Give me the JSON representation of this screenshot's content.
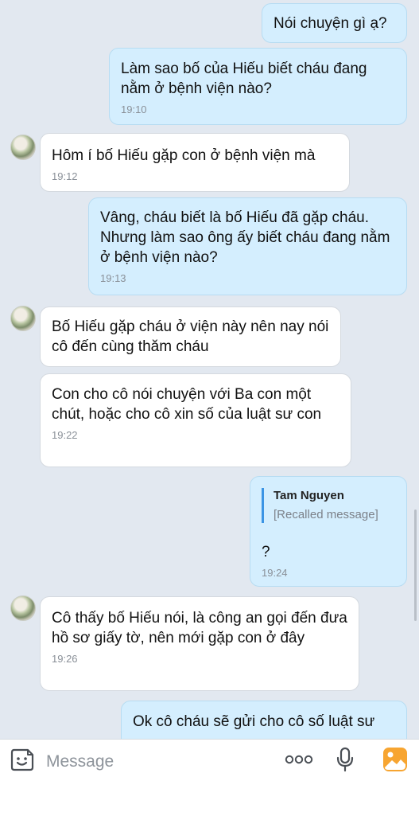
{
  "messages": [
    {
      "dir": "out",
      "text": "Nói chuyện gì ạ?",
      "time": ""
    },
    {
      "dir": "out",
      "text": "Làm sao bố của Hiếu biết cháu đang nằm ở bệnh viện nào?",
      "time": "19:10"
    },
    {
      "dir": "in",
      "text": "Hôm í bố Hiếu gặp con ở bệnh viện mà",
      "time": "19:12"
    },
    {
      "dir": "out",
      "text": "Vâng, cháu biết là bố Hiếu đã gặp cháu. Nhưng làm sao ông ấy biết cháu đang nằm ở bệnh viện nào?",
      "time": "19:13"
    },
    {
      "dir": "in",
      "text": "Bố Hiếu gặp cháu ở viện này nên nay nói cô đến cùng thăm cháu",
      "time": ""
    },
    {
      "dir": "in",
      "text": "Con cho cô nói chuyện với Ba con một chút, hoặc cho cô xin số của luật sư con",
      "time": "19:22"
    },
    {
      "dir": "out",
      "text": "?",
      "time": "19:24",
      "quote_name": "Tam Nguyen",
      "quote_text": "[Recalled message]"
    },
    {
      "dir": "in",
      "text": "Cô thấy bố Hiếu nói, là công an gọi đến đưa hồ sơ giấy tờ, nên mới gặp con ở đây",
      "time": "19:26"
    },
    {
      "dir": "out",
      "text": "Ok cô cháu sẽ gửi cho cô số luật sư",
      "time": ""
    }
  ],
  "input": {
    "placeholder": "Message",
    "sticker_icon": "sticker-face-icon",
    "more_icon": "more-dots-icon",
    "mic_icon": "microphone-icon",
    "image_icon": "image-gallery-icon"
  },
  "colors": {
    "background": "#e2e8f0",
    "outgoing_bubble": "#d4eefe",
    "incoming_bubble": "#ffffff",
    "quote_bar": "#3b94e4",
    "image_icon": "#f7a531"
  }
}
